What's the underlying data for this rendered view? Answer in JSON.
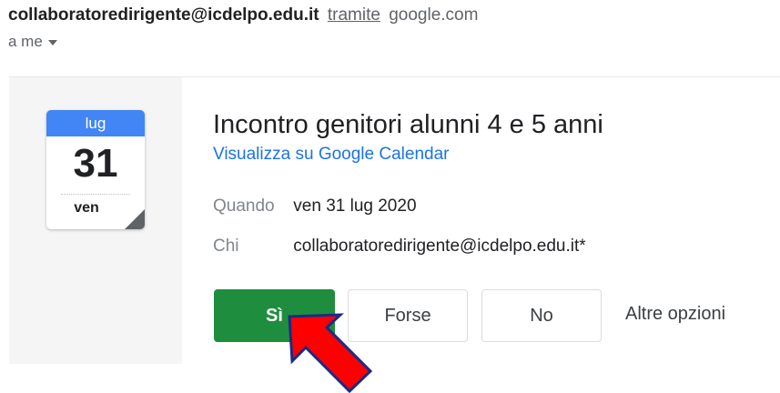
{
  "header": {
    "sender_email": "collaboratoredirigente@icdelpo.edu.it",
    "via_label": "tramite",
    "via_domain": "google.com",
    "recipient": "a me"
  },
  "calendar_icon": {
    "month": "lug",
    "day": "31",
    "weekday": "ven",
    "month_color": "#4285f4"
  },
  "event": {
    "title": "Incontro genitori alunni 4 e 5 anni",
    "view_link": "Visualizza su Google Calendar",
    "when_label": "Quando",
    "when_value": "ven 31 lug 2020",
    "who_label": "Chi",
    "who_value": "collaboratoredirigente@icdelpo.edu.it*"
  },
  "rsvp": {
    "yes_label": "Sì",
    "maybe_label": "Forse",
    "no_label": "No",
    "more_label": "Altre opzioni",
    "yes_color": "#1e8e3e"
  },
  "annotation": {
    "icon": "red-arrow-icon",
    "color": "#ff0000"
  }
}
